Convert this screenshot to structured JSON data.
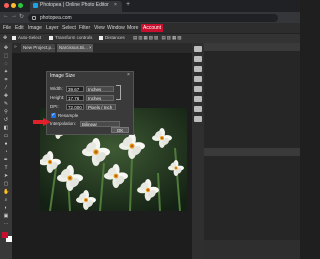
{
  "browser": {
    "tab_title": "Photopea | Online Photo Editor",
    "tab_close": "×",
    "new_tab": "+",
    "url": "photopea.com",
    "nav_icons": [
      "←",
      "→",
      "↻"
    ]
  },
  "menu": {
    "items": [
      "File",
      "Edit",
      "Image",
      "Layer",
      "Select",
      "Filter",
      "View",
      "Window",
      "More"
    ],
    "account": "Account"
  },
  "options": {
    "auto_select": "Auto-Select",
    "transform_controls": "Transform controls",
    "distances": "Distances"
  },
  "docs": {
    "tabs": [
      "New Project.p... ×",
      "Narcissus.Bi... ×"
    ]
  },
  "dialog": {
    "title": "Image Size",
    "close": "×",
    "width_label": "Width:",
    "width_value": "39.67",
    "width_unit": "Inches",
    "height_label": "Height:",
    "height_value": "17.76",
    "height_unit": "Inches",
    "dpi_label": "DPI:",
    "dpi_value": "72.000",
    "dpi_unit": "Pixels / Inch",
    "resample_label": "Resample",
    "interp_label": "Interpolation:",
    "interp_value": "Bilinear",
    "ok_label": "OK"
  },
  "colors": {
    "accent": "#c8102e",
    "arrow": "#e0202a",
    "foreground": "#c8102e",
    "background": "#ffffff"
  }
}
